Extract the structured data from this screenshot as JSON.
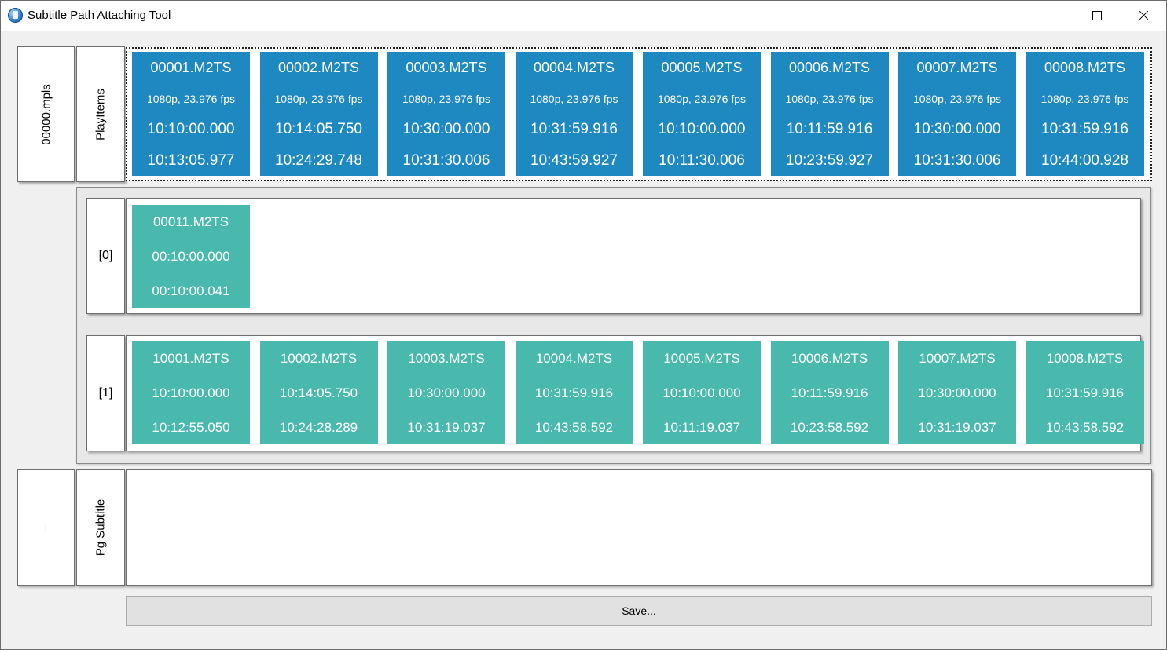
{
  "window": {
    "title": "Subtitle Path Attaching Tool",
    "controls": [
      "minimize",
      "maximize",
      "close"
    ]
  },
  "playlist": {
    "name": "00000.mpls",
    "row_label": "PlayItems",
    "items": [
      {
        "file": "00001.M2TS",
        "format": "1080p, 23.976 fps",
        "in": "10:10:00.000",
        "out": "10:13:05.977"
      },
      {
        "file": "00002.M2TS",
        "format": "1080p, 23.976 fps",
        "in": "10:14:05.750",
        "out": "10:24:29.748"
      },
      {
        "file": "00003.M2TS",
        "format": "1080p, 23.976 fps",
        "in": "10:30:00.000",
        "out": "10:31:30.006"
      },
      {
        "file": "00004.M2TS",
        "format": "1080p, 23.976 fps",
        "in": "10:31:59.916",
        "out": "10:43:59.927"
      },
      {
        "file": "00005.M2TS",
        "format": "1080p, 23.976 fps",
        "in": "10:10:00.000",
        "out": "10:11:30.006"
      },
      {
        "file": "00006.M2TS",
        "format": "1080p, 23.976 fps",
        "in": "10:11:59.916",
        "out": "10:23:59.927"
      },
      {
        "file": "00007.M2TS",
        "format": "1080p, 23.976 fps",
        "in": "10:30:00.000",
        "out": "10:31:30.006"
      },
      {
        "file": "00008.M2TS",
        "format": "1080p, 23.976 fps",
        "in": "10:31:59.916",
        "out": "10:44:00.928"
      }
    ]
  },
  "subpaths": [
    {
      "label": "[0]",
      "items": [
        {
          "file": "00011.M2TS",
          "in": "00:10:00.000",
          "out": "00:10:00.041"
        }
      ]
    },
    {
      "label": "[1]",
      "items": [
        {
          "file": "10001.M2TS",
          "in": "10:10:00.000",
          "out": "10:12:55.050"
        },
        {
          "file": "10002.M2TS",
          "in": "10:14:05.750",
          "out": "10:24:28.289"
        },
        {
          "file": "10003.M2TS",
          "in": "10:30:00.000",
          "out": "10:31:19.037"
        },
        {
          "file": "10004.M2TS",
          "in": "10:31:59.916",
          "out": "10:43:58.592"
        },
        {
          "file": "10005.M2TS",
          "in": "10:10:00.000",
          "out": "10:11:19.037"
        },
        {
          "file": "10006.M2TS",
          "in": "10:11:59.916",
          "out": "10:23:58.592"
        },
        {
          "file": "10007.M2TS",
          "in": "10:30:00.000",
          "out": "10:31:19.037"
        },
        {
          "file": "10008.M2TS",
          "in": "10:31:59.916",
          "out": "10:43:58.592"
        }
      ]
    }
  ],
  "add_row": {
    "add_label": "+",
    "type_label": "Pg Subtitle"
  },
  "save_button": "Save...",
  "colors": {
    "playitem_tile": "#1e88c0",
    "subpath_tile": "#49b9ae"
  }
}
